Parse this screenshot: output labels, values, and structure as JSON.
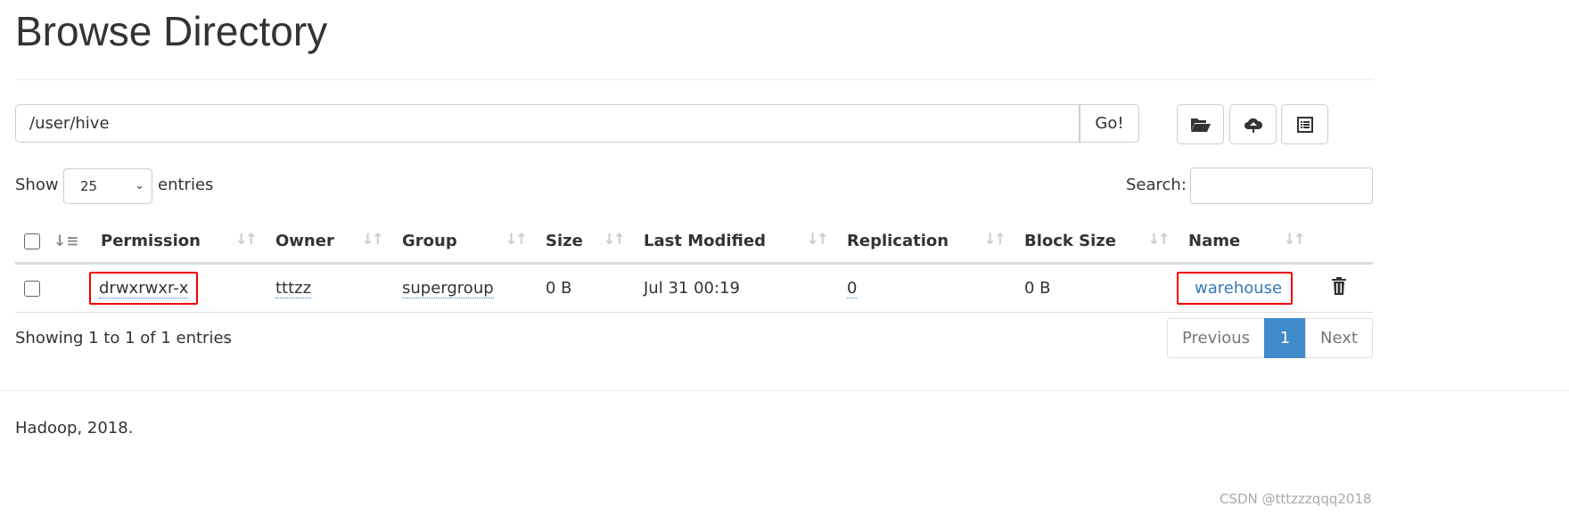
{
  "title": "Browse Directory",
  "path": {
    "value": "/user/hive",
    "go_label": "Go!"
  },
  "toolbar": {
    "icons": [
      "folder-open-icon",
      "cloud-upload-icon",
      "list-icon"
    ]
  },
  "length": {
    "show": "Show",
    "value": "25",
    "entries": "entries"
  },
  "search": {
    "label": "Search:",
    "value": ""
  },
  "table": {
    "headers": [
      "Permission",
      "Owner",
      "Group",
      "Size",
      "Last Modified",
      "Replication",
      "Block Size",
      "Name"
    ],
    "rows": [
      {
        "permission": "drwxrwxr-x",
        "owner": "tttzz",
        "group": "supergroup",
        "size": "0 B",
        "last_modified": "Jul 31 00:19",
        "replication": "0",
        "block_size": "0 B",
        "name": "warehouse"
      }
    ]
  },
  "info": "Showing 1 to 1 of 1 entries",
  "pagination": {
    "previous": "Previous",
    "current": "1",
    "next": "Next"
  },
  "footer": "Hadoop, 2018.",
  "watermark": "CSDN @tttzzzqqq2018",
  "colors": {
    "accent": "#428bca",
    "link": "#337ab7",
    "highlight": "#e00000"
  }
}
